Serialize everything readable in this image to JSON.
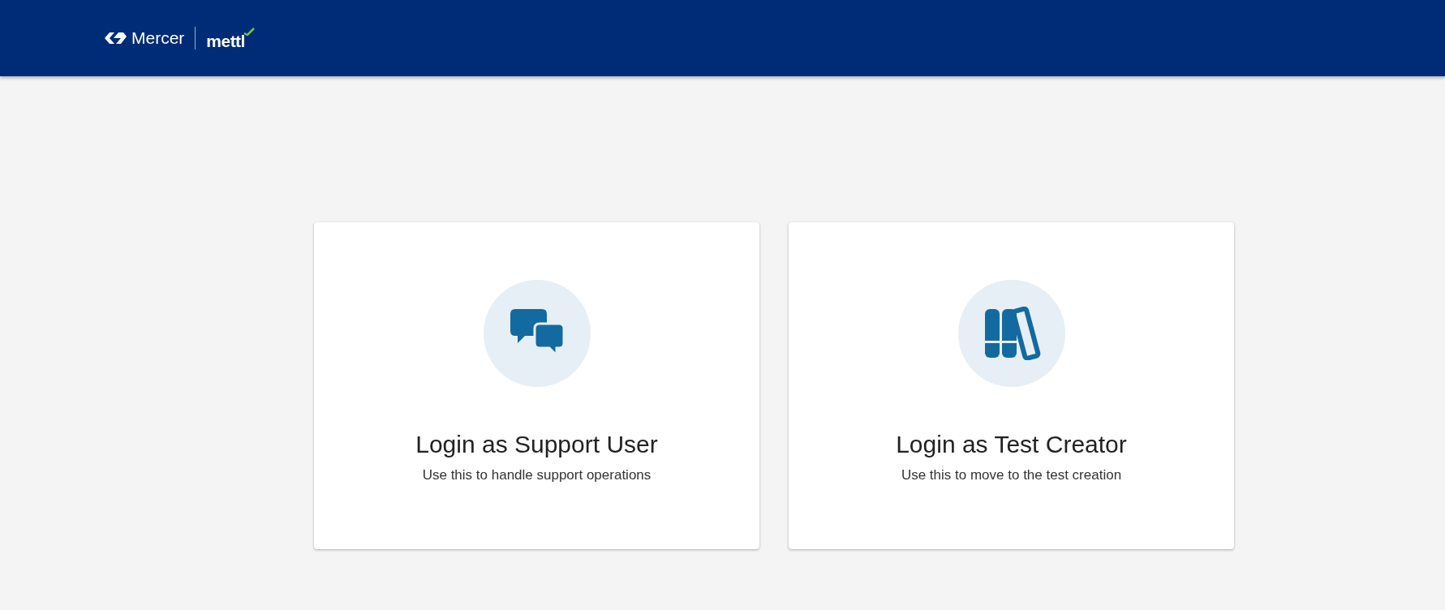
{
  "header": {
    "brand": "Mercer",
    "product": "mettl"
  },
  "cards": [
    {
      "title": "Login as Support User",
      "subtitle": "Use this to handle support operations"
    },
    {
      "title": "Login as Test Creator",
      "subtitle": "Use this to move to the test creation"
    }
  ]
}
